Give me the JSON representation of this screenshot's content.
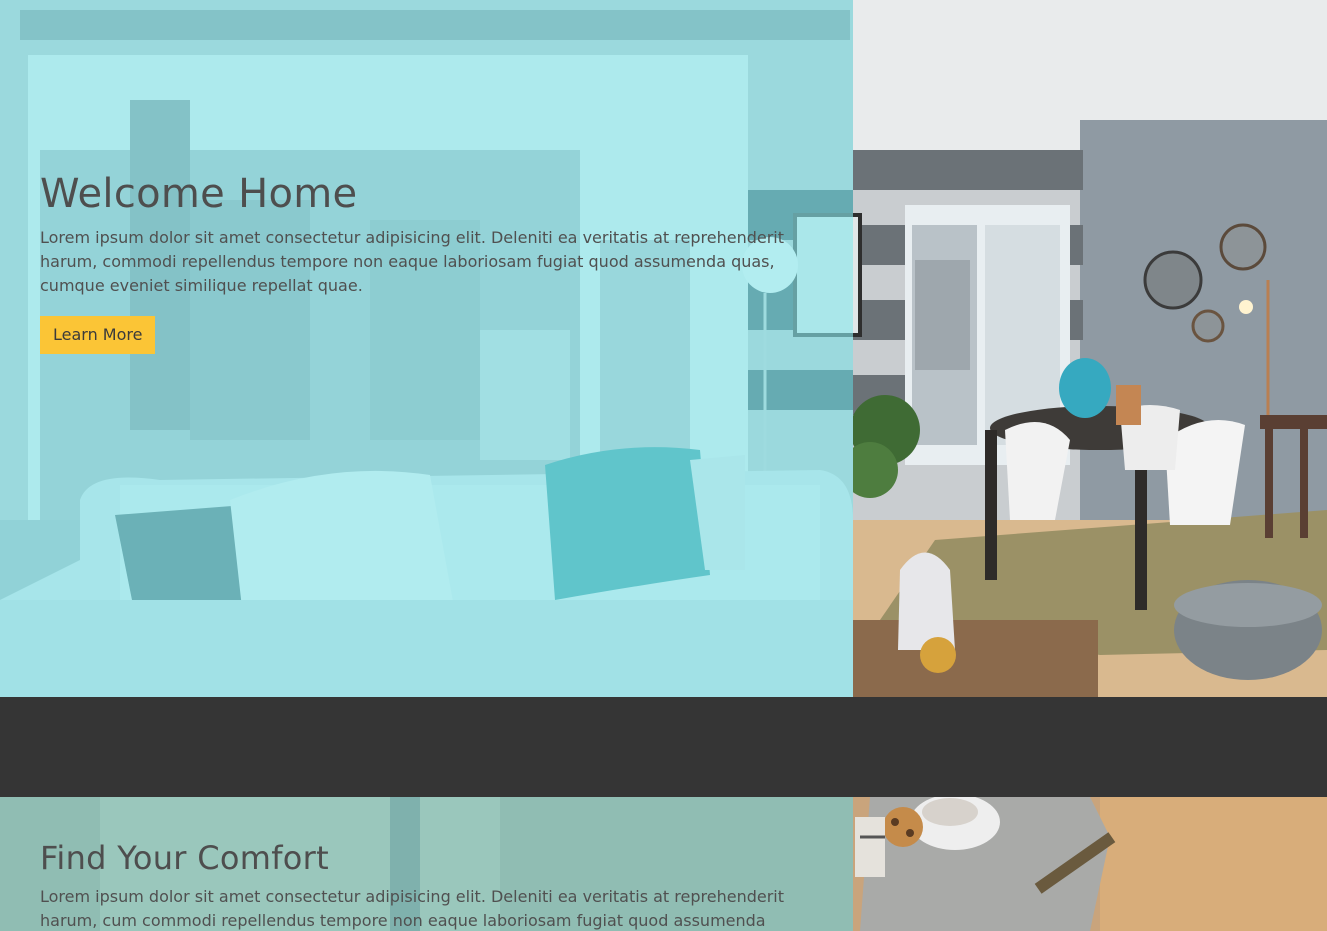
{
  "hero": {
    "title": "Welcome Home",
    "text": "Lorem ipsum dolor sit amet consectetur adipisicing elit. Deleniti ea veritatis at reprehenderit harum, commodi repellendus tempore non eaque laboriosam fugiat quod assumenda quas, cumque eveniet similique repellat quae.",
    "button_label": "Learn More"
  },
  "section2": {
    "title": "Find Your Comfort",
    "text": "Lorem ipsum dolor sit amet consectetur adipisicing elit. Deleniti ea veritatis at reprehenderit harum, cum commodi repellendus tempore non eaque laboriosam fugiat quod assumenda"
  },
  "colors": {
    "overlay": "#89e6ec",
    "button": "#fbc536",
    "band": "#353535"
  }
}
